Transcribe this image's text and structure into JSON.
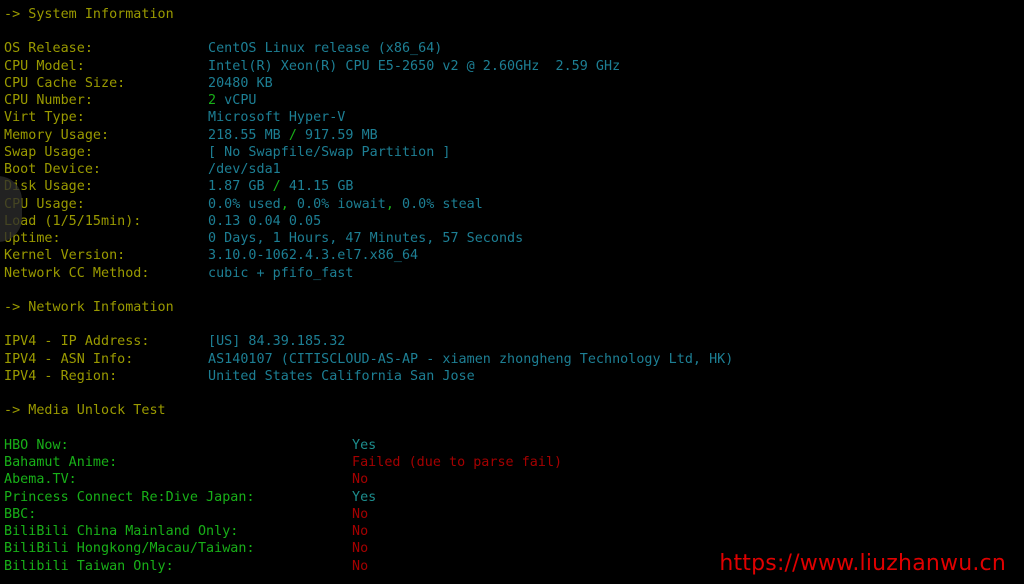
{
  "terminal": {
    "background_color": "#000000",
    "label_color": "#9a9a00",
    "value_color": "#1d7f94",
    "green_color": "#18b018",
    "red_color": "#a40000",
    "watermark_color": "#e00000"
  },
  "sections": {
    "system": {
      "heading": "-> System Information",
      "rows": [
        {
          "label": "OS Release:",
          "value": "CentOS Linux release (x86_64)"
        },
        {
          "label": "CPU Model:",
          "value": "Intel(R) Xeon(R) CPU E5-2650 v2 @ 2.60GHz  2.59 GHz"
        },
        {
          "label": "CPU Cache Size:",
          "value": "20480 KB"
        },
        {
          "label": "CPU Number:",
          "value_pre": "2",
          "value_post": " vCPU"
        },
        {
          "label": "Virt Type:",
          "value": "Microsoft Hyper-V"
        },
        {
          "label": "Memory Usage:",
          "value_a": "218.55 MB ",
          "value_sep": "/",
          "value_b": " 917.59 MB"
        },
        {
          "label": "Swap Usage:",
          "value": "[ No Swapfile/Swap Partition ]"
        },
        {
          "label": "Boot Device:",
          "value": "/dev/sda1"
        },
        {
          "label": "Disk Usage:",
          "value_a": "1.87 GB ",
          "value_sep": "/",
          "value_b": " 41.15 GB"
        },
        {
          "label": "CPU Usage:",
          "value_a": "0.0% used",
          "value_sep": ",",
          "value_b": " 0.0% iowait",
          "value_sep2": ",",
          "value_c": " 0.0% steal"
        },
        {
          "label": "Load (1/5/15min):",
          "value": "0.13 0.04 0.05"
        },
        {
          "label": "Uptime:",
          "value": "0 Days, 1 Hours, 47 Minutes, 57 Seconds"
        },
        {
          "label": "Kernel Version:",
          "value": "3.10.0-1062.4.3.el7.x86_64"
        },
        {
          "label": "Network CC Method:",
          "value": "cubic + pfifo_fast"
        }
      ]
    },
    "network": {
      "heading": "-> Network Infomation",
      "rows": [
        {
          "label": "IPV4 - IP Address:",
          "value": "[US] 84.39.185.32"
        },
        {
          "label": "IPV4 - ASN Info:",
          "value": "AS140107 (CITISCLOUD-AS-AP - xiamen zhongheng Technology Ltd, HK)"
        },
        {
          "label": "IPV4 - Region:",
          "value": "United States California San Jose"
        }
      ]
    },
    "media": {
      "heading": "-> Media Unlock Test",
      "rows": [
        {
          "label": "HBO Now:",
          "value": "Yes",
          "status": "yes"
        },
        {
          "label": "Bahamut Anime:",
          "value": "Failed (due to parse fail)",
          "status": "failed"
        },
        {
          "label": "Abema.TV:",
          "value": "No",
          "status": "no"
        },
        {
          "label": "Princess Connect Re:Dive Japan:",
          "value": "Yes",
          "status": "yes"
        },
        {
          "label": "BBC:",
          "value": "No",
          "status": "no"
        },
        {
          "label": "BiliBili China Mainland Only:",
          "value": "No",
          "status": "no"
        },
        {
          "label": "BiliBili Hongkong/Macau/Taiwan:",
          "value": "No",
          "status": "no"
        },
        {
          "label": "Bilibili Taiwan Only:",
          "value": "No",
          "status": "no"
        }
      ]
    }
  },
  "watermark": {
    "text": "https://www.liuzhanwu.cn"
  }
}
